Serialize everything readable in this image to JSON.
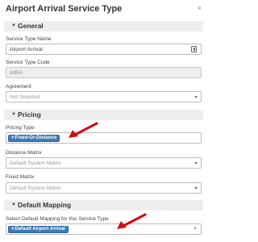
{
  "dialog": {
    "title": "Airport Arrival Service Type",
    "close_symbol": "×"
  },
  "general": {
    "header": "General",
    "service_type_name": {
      "label": "Service Type Name",
      "value": "Airport Arrival"
    },
    "service_type_code": {
      "label": "Service Type Code",
      "value": "AIRA"
    },
    "agreement": {
      "label": "Agreement",
      "placeholder": "Not Selected"
    }
  },
  "pricing": {
    "header": "Pricing",
    "pricing_type": {
      "label": "Pricing Type",
      "tag": "Fixed-Or-Distance"
    },
    "distance_matrix": {
      "label": "Distance Matrix",
      "placeholder": "Default System Matrix"
    },
    "fixed_matrix": {
      "label": "Fixed Matrix",
      "placeholder": "Default System Matrix"
    }
  },
  "default_mapping": {
    "header": "Default Mapping",
    "select_mapping": {
      "label": "Select Default Mapping for this Service Type",
      "tag": "Default Airport Arrival",
      "clear_symbol": "×"
    }
  },
  "icons": {
    "caret": "caret-down-icon",
    "arrow_color": "#cc1111",
    "tag_color": "#3e7bb5"
  }
}
